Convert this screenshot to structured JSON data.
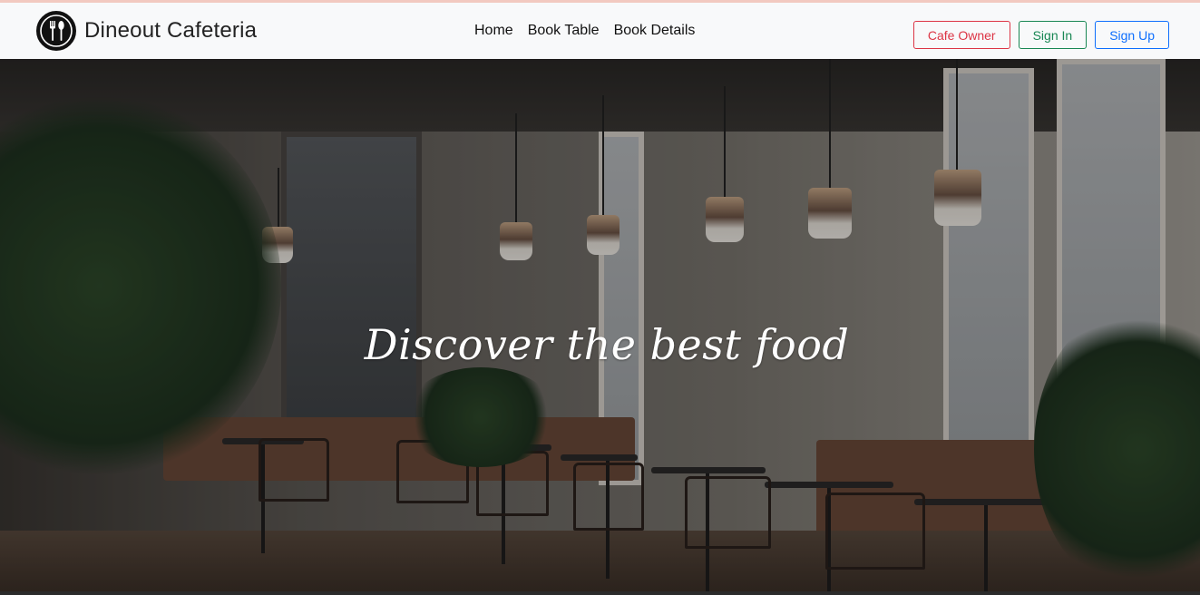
{
  "brand": {
    "name": "Dineout Cafeteria",
    "logo_icon": "fork-spoon-icon"
  },
  "nav": {
    "links": [
      "Home",
      "Book Table",
      "Book Details"
    ]
  },
  "auth": {
    "cafe_owner": "Cafe Owner",
    "sign_in": "Sign In",
    "sign_up": "Sign Up"
  },
  "hero": {
    "title": "Discover the best food"
  },
  "colors": {
    "navbar_bg": "#f8f9fa",
    "danger": "#dc3545",
    "success": "#198754",
    "primary": "#0d6efd"
  }
}
